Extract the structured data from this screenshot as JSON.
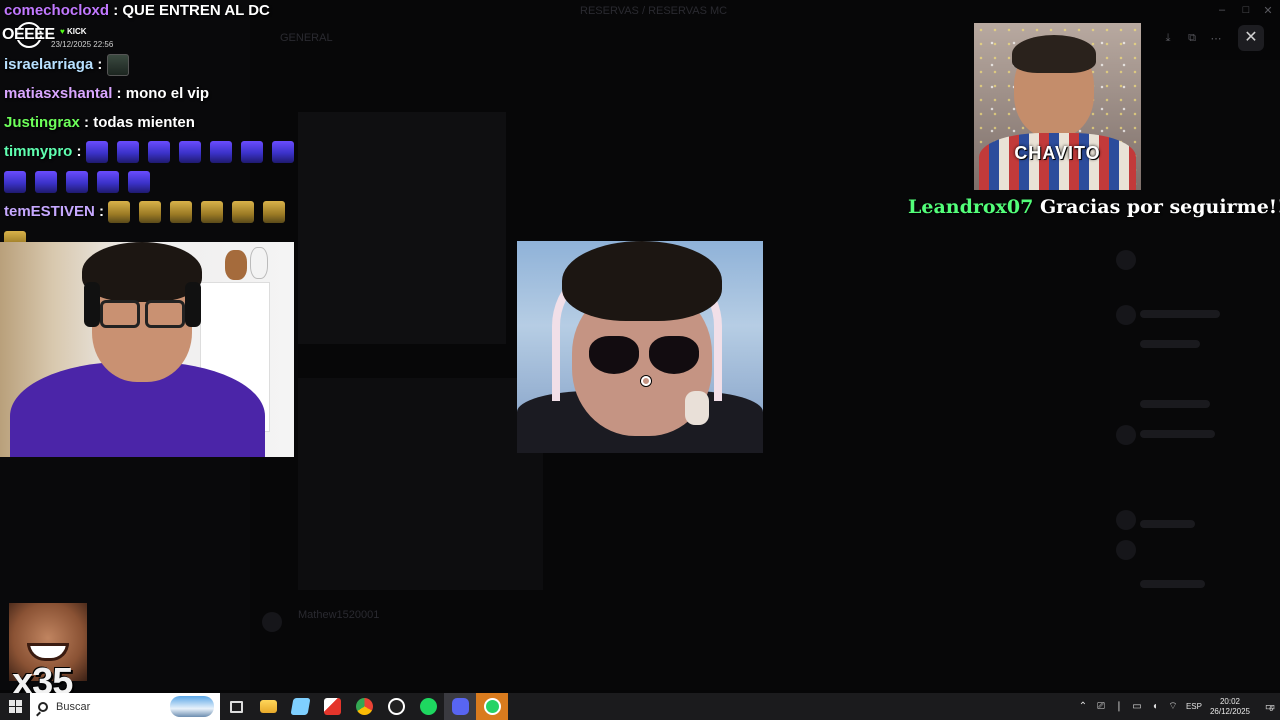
{
  "chat": {
    "top_message": {
      "user": "comechocloxd",
      "user_color": "#c178ff",
      "text": "QUE ENTREN AL DC"
    },
    "overlay": {
      "shout": "OEEEE",
      "badge": "KICK",
      "timestamp": "23/12/2025 22:56"
    },
    "messages": [
      {
        "user": "israelarriaga",
        "user_color": "#b7e0ff",
        "text": "",
        "emote_kind": "box",
        "emote_count": 1
      },
      {
        "user": "matiasxshantal",
        "user_color": "#d9a6ff",
        "text": "mono el vip",
        "emote_kind": "",
        "emote_count": 0
      },
      {
        "user": "Justingrax",
        "user_color": "#6dff5a",
        "text": "todas mienten",
        "emote_kind": "",
        "emote_count": 0
      },
      {
        "user": "timmypro",
        "user_color": "#5fffb0",
        "text": "",
        "emote_kind": "blue",
        "emote_count": 12
      },
      {
        "user": "temESTIVEN",
        "user_color": "#c6a8ff",
        "text": "",
        "emote_kind": "gold",
        "emote_count": 7
      }
    ]
  },
  "alerts": {
    "gift_label": "CHAVITO",
    "follower_name": "Leandrox07",
    "follow_text": "Gracias por seguirme!!"
  },
  "combo": {
    "text": "x35"
  },
  "background_app": {
    "title": "RESERVAS / RESERVAS MC",
    "channel": "GENERAL",
    "footer_user": "Mathew1520001"
  },
  "taskbar": {
    "search_placeholder": "Buscar",
    "language": "ESP",
    "time": "20:02",
    "date": "26/12/2025",
    "notifications": "6",
    "pinned": [
      "task-view",
      "file-explorer",
      "notepad",
      "app-red",
      "chrome",
      "app-dark",
      "spotify",
      "discord",
      "whatsapp"
    ]
  },
  "colors": {
    "follower_name": "#53ff7a",
    "spotify": "#1ed760",
    "discord": "#5865f2",
    "whatsapp": "#25d366",
    "taskbar": "#1b1b1d"
  }
}
